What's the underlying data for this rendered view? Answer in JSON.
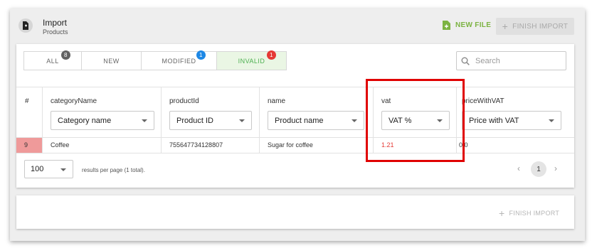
{
  "header": {
    "title": "Import",
    "subtitle": "Products",
    "new_file_label": "NEW FILE",
    "finish_import_label": "FINISH IMPORT"
  },
  "tabs": [
    {
      "label": "ALL",
      "badge": "8",
      "badge_color": "#616161",
      "active": false
    },
    {
      "label": "NEW",
      "badge": "",
      "active": false
    },
    {
      "label": "MODIFIED",
      "badge": "1",
      "badge_color": "#1e88e5",
      "active": false
    },
    {
      "label": "INVALID",
      "badge": "1",
      "badge_color": "#e53935",
      "active": true
    }
  ],
  "search": {
    "placeholder": "Search"
  },
  "table": {
    "row_number_header": "#",
    "columns": [
      {
        "name": "categoryName",
        "mapping": "Category name"
      },
      {
        "name": "productId",
        "mapping": "Product ID"
      },
      {
        "name": "name",
        "mapping": "Product name"
      },
      {
        "name": "vat",
        "mapping": "VAT %"
      },
      {
        "name": "priceWithVAT",
        "mapping": "Price with VAT"
      }
    ],
    "rows": [
      {
        "num": "9",
        "cells": [
          "Coffee",
          "755647734128807",
          "Sugar for coffee",
          "1.21",
          "0.0"
        ]
      }
    ]
  },
  "pagination": {
    "per_page": "100",
    "summary": "results per page (1 total).",
    "page": "1",
    "prev_icon": "chevron-left-icon",
    "next_icon": "chevron-right-icon"
  },
  "footer": {
    "finish_import_label": "FINISH IMPORT"
  },
  "colors": {
    "accent_green": "#7cb342",
    "error_red": "#e53935",
    "highlight_red": "#e00000"
  }
}
